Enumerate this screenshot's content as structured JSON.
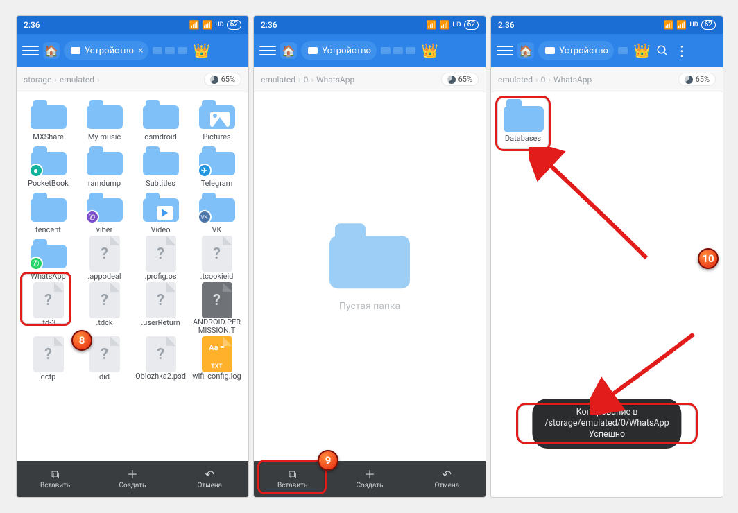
{
  "status": {
    "time": "2:36",
    "battery": "62"
  },
  "header": {
    "tab_label": "Устройство",
    "crown": "👑"
  },
  "breadcrumb1": {
    "a": "storage",
    "b": "emulated",
    "pct": "65%"
  },
  "breadcrumb2": {
    "a": "emulated",
    "b": "0",
    "c": "WhatsApp",
    "pct": "65%"
  },
  "breadcrumb3": {
    "a": "emulated",
    "b": "0",
    "c": "WhatsApp",
    "pct": "65%"
  },
  "screen1_items": [
    {
      "label": "MXShare",
      "type": "folder"
    },
    {
      "label": "My music",
      "type": "folder"
    },
    {
      "label": "osmdroid",
      "type": "folder"
    },
    {
      "label": "Pictures",
      "type": "folder",
      "overlay": "picture"
    },
    {
      "label": "PocketBook",
      "type": "folder",
      "badge": "#0fb39a",
      "badgeText": "●"
    },
    {
      "label": "ramdump",
      "type": "folder"
    },
    {
      "label": "Subtitles",
      "type": "folder"
    },
    {
      "label": "Telegram",
      "type": "folder",
      "badge": "#2396e0",
      "badgeText": "✈"
    },
    {
      "label": "tencent",
      "type": "folder"
    },
    {
      "label": "viber",
      "type": "folder",
      "badge": "#7a4ecb",
      "badgeText": "✆"
    },
    {
      "label": "Video",
      "type": "folder",
      "overlay": "play"
    },
    {
      "label": "VK",
      "type": "folder",
      "badge": "#4a76a8",
      "badgeText": "VK"
    },
    {
      "label": "WhatsApp",
      "type": "folder",
      "badge": "#25d366",
      "badgeText": "✆"
    },
    {
      "label": ".appodeal",
      "type": "fileq"
    },
    {
      "label": ".profig.os",
      "type": "fileq"
    },
    {
      "label": ".tcookieid",
      "type": "fileq"
    },
    {
      "label": ".td-3",
      "type": "fileq"
    },
    {
      "label": ".tdck",
      "type": "fileq"
    },
    {
      "label": ".userReturn",
      "type": "fileq"
    },
    {
      "label": "ANDROID.PERMISSION.T",
      "type": "fileq",
      "dark": true,
      "multiline": true
    },
    {
      "label": "dctp",
      "type": "fileq"
    },
    {
      "label": "did",
      "type": "fileq"
    },
    {
      "label": "Oblozhka2.psd",
      "type": "fileq",
      "multiline": true
    },
    {
      "label": "wifi_config.log",
      "type": "txt",
      "multiline": true
    }
  ],
  "screen3_items": [
    {
      "label": "Databases",
      "type": "folder"
    }
  ],
  "empty_label": "Пустая папка",
  "bottombar": {
    "paste": "Вставить",
    "create": "Создать",
    "cancel": "Отмена"
  },
  "toast": "Копирование в /storage/emulated/0/WhatsApp Успешно",
  "steps": {
    "s8": "8",
    "s9": "9",
    "s10": "10"
  }
}
